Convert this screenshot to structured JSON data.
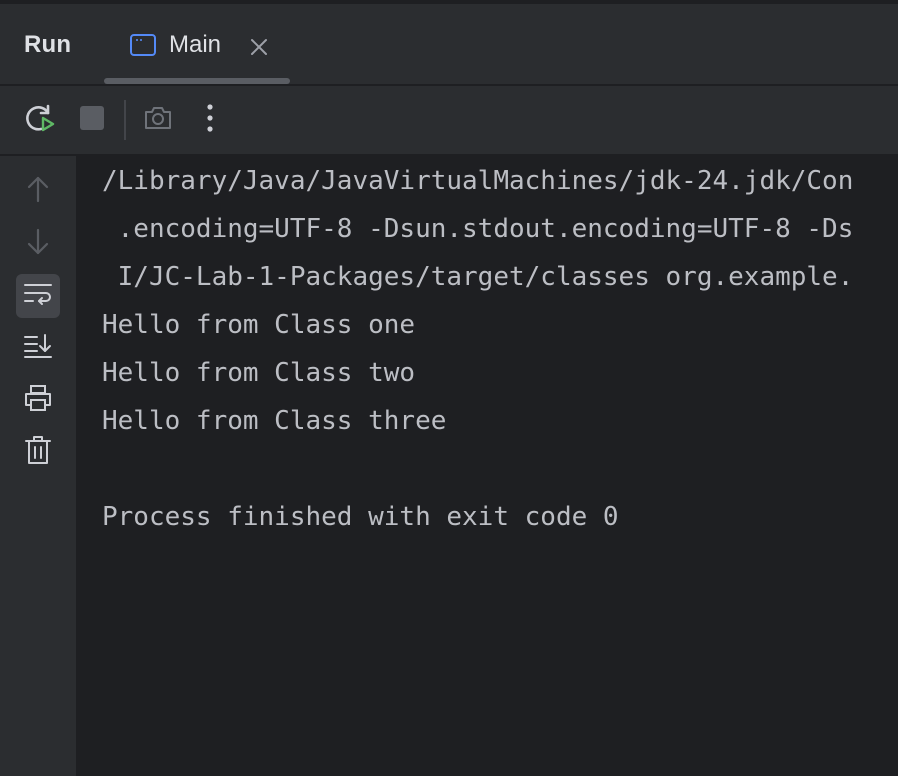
{
  "panel": {
    "title": "Run"
  },
  "tabs": [
    {
      "label": "Main",
      "icon": "console-window-icon",
      "active": true
    }
  ],
  "toolbar": {
    "buttons": [
      {
        "name": "rerun",
        "icon": "rerun-icon"
      },
      {
        "name": "stop",
        "icon": "stop-icon"
      },
      {
        "name": "screenshot",
        "icon": "camera-icon"
      },
      {
        "name": "more",
        "icon": "more-vertical-icon"
      }
    ]
  },
  "gutter": {
    "buttons": [
      {
        "name": "up",
        "icon": "arrow-up-icon"
      },
      {
        "name": "down",
        "icon": "arrow-down-icon"
      },
      {
        "name": "soft-wrap",
        "icon": "soft-wrap-icon",
        "active": true
      },
      {
        "name": "scroll-to-end",
        "icon": "scroll-to-end-icon"
      },
      {
        "name": "print",
        "icon": "print-icon"
      },
      {
        "name": "clear",
        "icon": "trash-icon"
      }
    ]
  },
  "console": {
    "lines": [
      "/Library/Java/JavaVirtualMachines/jdk-24.jdk/Con",
      " .encoding=UTF-8 -Dsun.stdout.encoding=UTF-8 -Ds",
      " I/JC-Lab-1-Packages/target/classes org.example.",
      "Hello from Class one",
      "Hello from Class two",
      "Hello from Class three",
      "",
      "Process finished with exit code 0"
    ]
  },
  "colors": {
    "panel_bg": "#2b2d30",
    "console_bg": "#1e1f22",
    "text": "#bcbec4",
    "run_icon_green": "#5fb865",
    "tab_icon_blue": "#548af7"
  }
}
